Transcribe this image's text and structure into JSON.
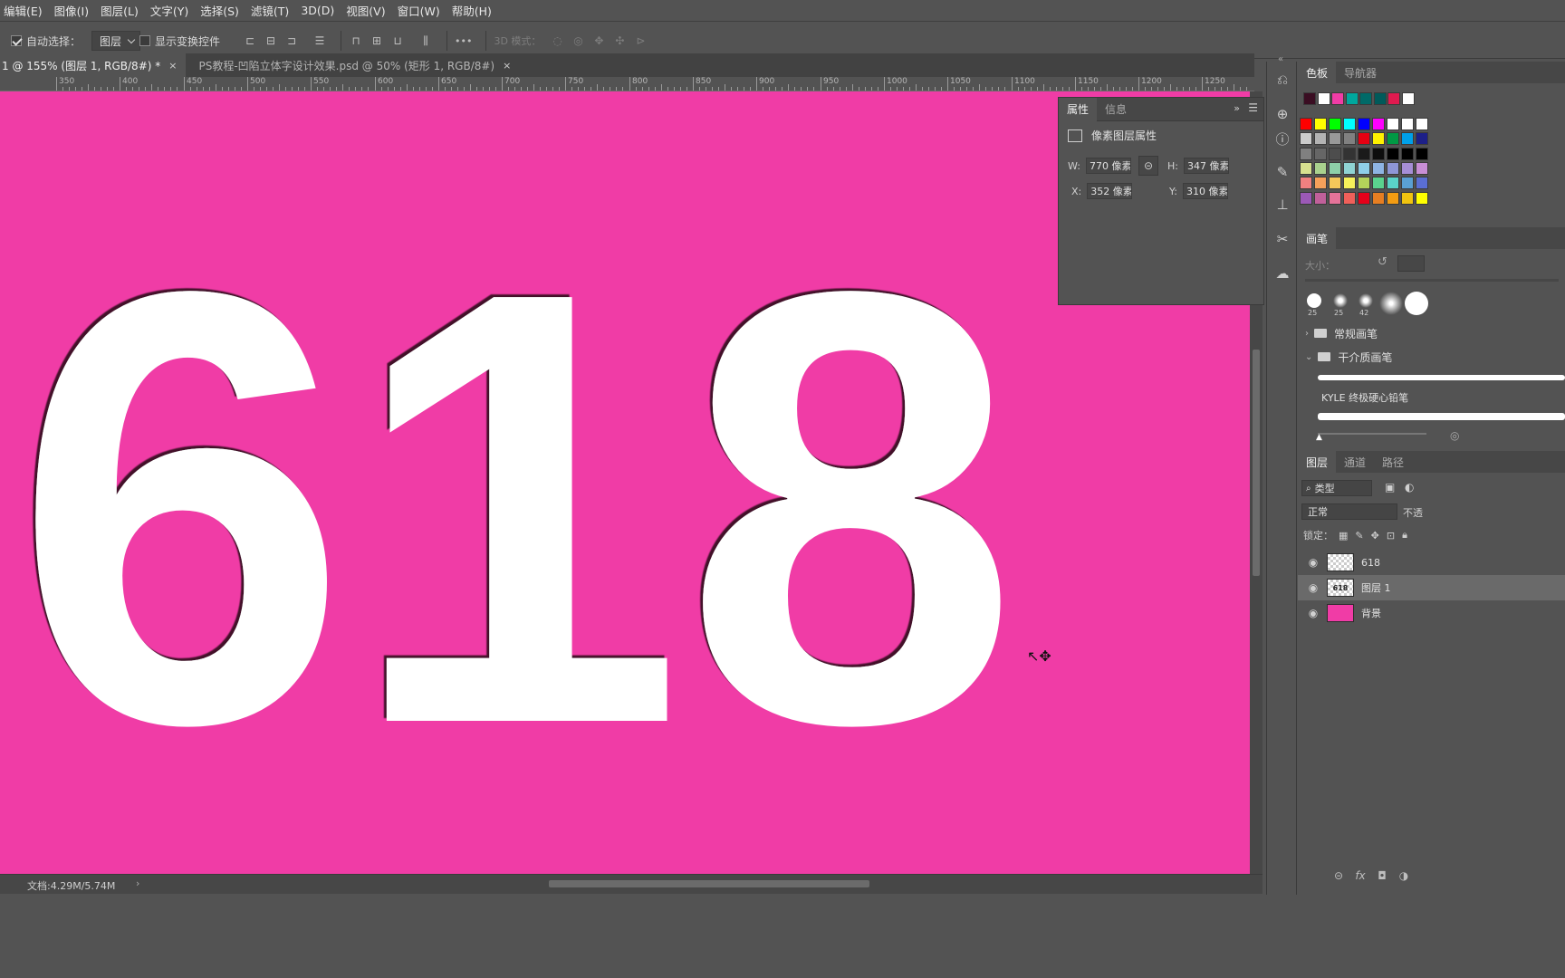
{
  "menu": [
    "编辑(E)",
    "图像(I)",
    "图层(L)",
    "文字(Y)",
    "选择(S)",
    "滤镜(T)",
    "3D(D)",
    "视图(V)",
    "窗口(W)",
    "帮助(H)"
  ],
  "options": {
    "auto_select_label": "自动选择：",
    "auto_select_value": "图层",
    "show_transform_label": "显示变换控件",
    "more_glyph": "•••",
    "mode_3d_label": "3D 模式："
  },
  "tabs": [
    {
      "label": "1 @ 155% (图层 1, RGB/8#) *",
      "close": "×"
    },
    {
      "label": "PS教程-凹陷立体字设计效果.psd @ 50% (矩形 1, RGB/8#)",
      "close": "×"
    }
  ],
  "ruler_labels": [
    "350",
    "400",
    "450",
    "500",
    "550",
    "600",
    "650",
    "700",
    "750",
    "800",
    "850",
    "900",
    "950",
    "1000",
    "1050",
    "1100",
    "1150",
    "1200",
    "1250"
  ],
  "canvas": {
    "text": "618",
    "bg_color": "#f03ca6",
    "text_color": "#ffffff"
  },
  "properties": {
    "tabs": [
      "属性",
      "信息"
    ],
    "section_title": "像素图层属性",
    "w_label": "W:",
    "w_value": "770 像素",
    "h_label": "H:",
    "h_value": "347 像素",
    "x_label": "X:",
    "x_value": "352 像素",
    "y_label": "Y:",
    "y_value": "310 像素"
  },
  "status": {
    "doc_size": "文档:4.29M/5.74M",
    "arrow": "›"
  },
  "color_panel": {
    "tabs": [
      "色板",
      "导航器"
    ],
    "recent": [
      "#3a0d22",
      "#ffffff",
      "#f03ca6",
      "#00a79d",
      "#006a68",
      "#005a5a",
      "#e01a4f",
      "#ffffff"
    ],
    "swatches": [
      [
        "#ff0000",
        "#ffff00",
        "#00ff00",
        "#00ffff",
        "#0000ff",
        "#ff00ff",
        "#ffffff",
        "#ffffff",
        "#ffffff"
      ],
      [
        "#cccccc",
        "#b3b3b3",
        "#999999",
        "#808080",
        "#e60012",
        "#fff100",
        "#009944",
        "#00a0e9",
        "#1d2088"
      ],
      [
        "#808080",
        "#666666",
        "#4d4d4d",
        "#333333",
        "#1a1a1a",
        "#0d0d0d",
        "#000000",
        "#000000",
        "#000000"
      ],
      [
        "#d7e08f",
        "#a9d18e",
        "#8ed0a9",
        "#8fd3d3",
        "#8ecfe8",
        "#8eb4e3",
        "#8e96d6",
        "#a68ed6",
        "#c88ed6"
      ],
      [
        "#f08080",
        "#f5a05a",
        "#f5c85a",
        "#f5f05a",
        "#b4d35a",
        "#5ad38e",
        "#5ad3c8",
        "#5aa0d3",
        "#5a6ed3"
      ],
      [
        "#9b59b6",
        "#c0609a",
        "#e57399",
        "#f0605a",
        "#e6001a",
        "#e67e22",
        "#f39c12",
        "#f1c40f",
        "#ffff00"
      ]
    ]
  },
  "brush_panel": {
    "tab": "画笔",
    "size_label": "大小：",
    "presets": [
      "25",
      "25",
      "42"
    ],
    "groups": [
      "常规画笔",
      "干介质画笔"
    ],
    "brush_name": "KYLE 终极硬心铅笔"
  },
  "layers_panel": {
    "tabs": [
      "图层",
      "通道",
      "路径"
    ],
    "filter_label": "类型",
    "blend_mode": "正常",
    "opacity_label": "不透",
    "lock_label": "锁定：",
    "layers": [
      {
        "name": "618",
        "thumb": "checker"
      },
      {
        "name": "图层 1",
        "thumb": "618"
      },
      {
        "name": "背景",
        "thumb": "pink"
      }
    ]
  },
  "icons": {
    "strip": [
      "history-icon",
      "color-sampler-icon",
      "info-icon",
      "brush-settings-icon",
      "clone-source-icon",
      "tool-presets-icon",
      "libraries-icon"
    ]
  }
}
